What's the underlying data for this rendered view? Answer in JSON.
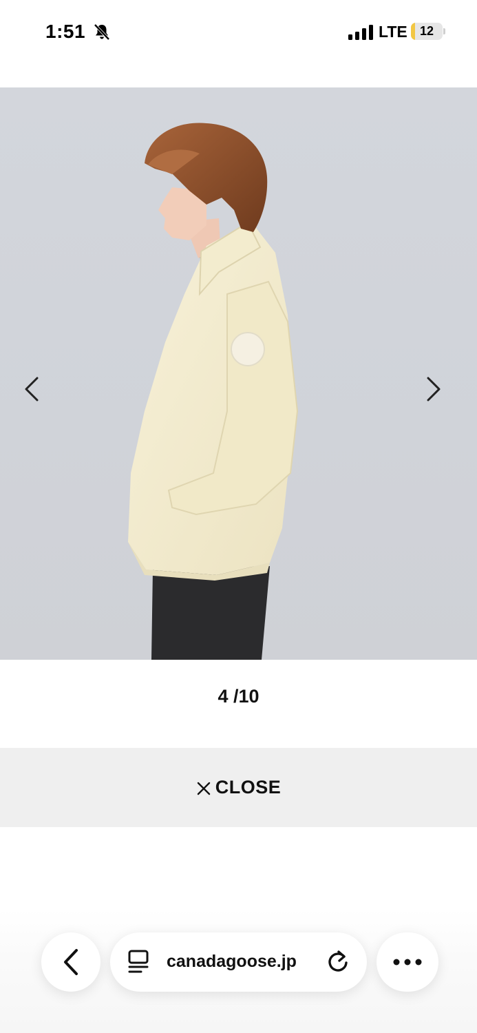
{
  "status_bar": {
    "time": "1:51",
    "network": "LTE",
    "battery_level": "12",
    "battery_fraction": 0.12,
    "icons": [
      "bell-slash-icon",
      "signal-icon",
      "battery-icon"
    ],
    "battery_color": "#f2c744"
  },
  "gallery": {
    "current": "4",
    "separator": " /",
    "total": "10",
    "prev_icon": "chevron-left-icon",
    "next_icon": "chevron-right-icon"
  },
  "close": {
    "icon": "close-icon",
    "label": "CLOSE"
  },
  "browser": {
    "url": "canadagoose.jp",
    "back_icon": "chevron-left-icon",
    "reader_icon": "reader-mode-icon",
    "reload_icon": "reload-icon",
    "more_icon": "more-icon"
  },
  "colors": {
    "photo_background": "#d2d5db",
    "close_bar_background": "#efefef",
    "text": "#111111"
  }
}
